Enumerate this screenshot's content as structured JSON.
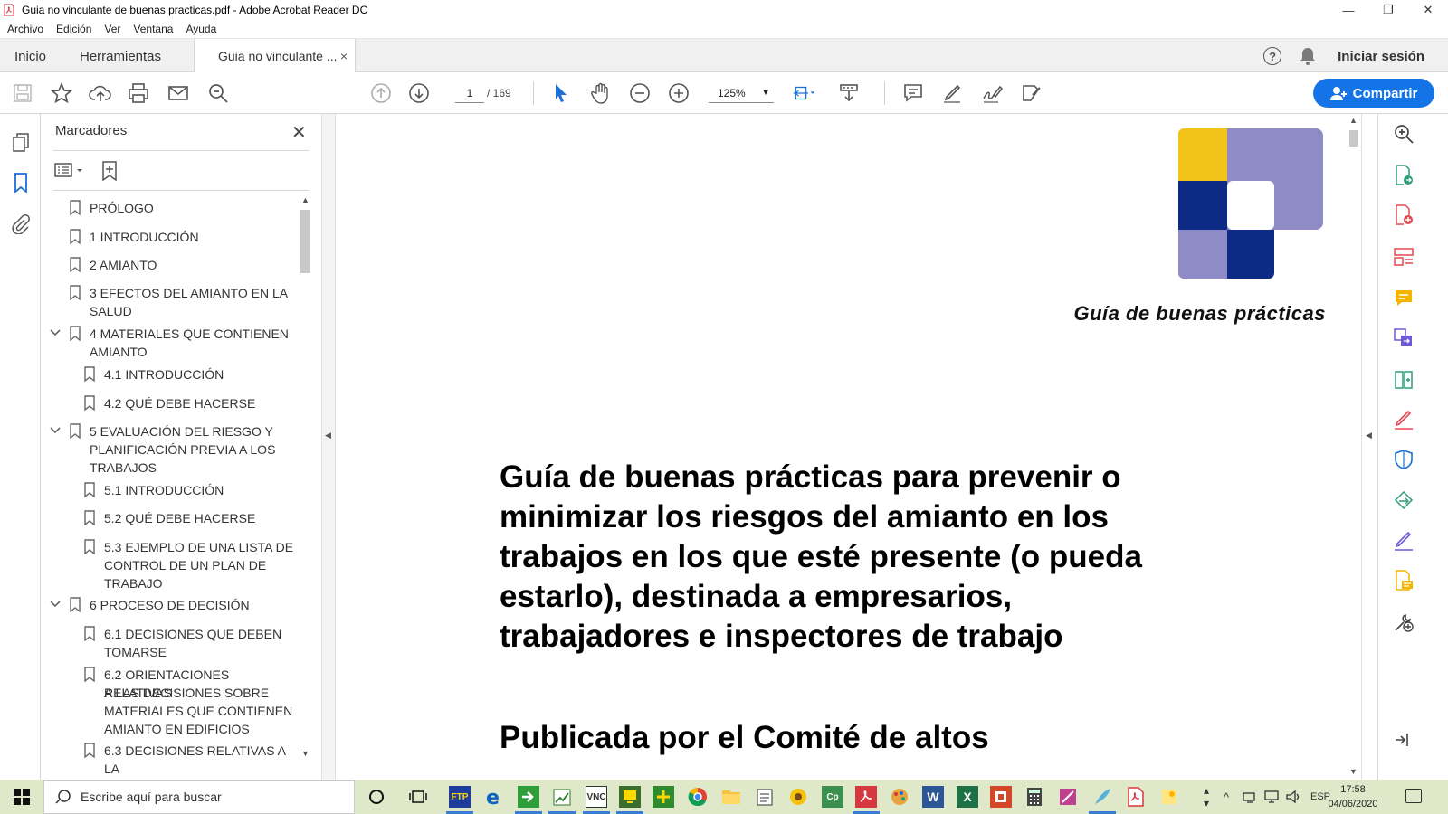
{
  "window": {
    "title": "Guia no vinculante de buenas practicas.pdf - Adobe Acrobat Reader DC",
    "controls": {
      "minimize": "—",
      "restore": "❐",
      "close": "✕"
    }
  },
  "menu": [
    "Archivo",
    "Edición",
    "Ver",
    "Ventana",
    "Ayuda"
  ],
  "tabs": {
    "home": "Inicio",
    "tools": "Herramientas",
    "document": "Guia no vinculante ...",
    "close": "×"
  },
  "header_right": {
    "help": "?",
    "signin": "Iniciar sesión"
  },
  "toolbar": {
    "page_current": "1",
    "page_total": "/   169",
    "zoom": "125%",
    "share_label": "Compartir"
  },
  "bookmarks": {
    "title": "Marcadores",
    "close": "✕",
    "items": [
      {
        "label": "PRÓLOGO",
        "level": 0,
        "expanded": null
      },
      {
        "label": "1 INTRODUCCIÓN",
        "level": 0,
        "expanded": null
      },
      {
        "label": "2 AMIANTO",
        "level": 0,
        "expanded": null
      },
      {
        "label": "3 EFECTOS DEL AMIANTO EN LA",
        "label2": "SALUD",
        "level": 0,
        "expanded": null
      },
      {
        "label": "4 MATERIALES QUE CONTIENEN",
        "label2": "AMIANTO",
        "level": 0,
        "expanded": true
      },
      {
        "label": "4.1 INTRODUCCIÓN",
        "level": 1
      },
      {
        "label": "4.2 QUÉ DEBE HACERSE",
        "level": 1
      },
      {
        "label": "5 EVALUACIÓN DEL RIESGO Y",
        "label2": "PLANIFICACIÓN PREVIA A LOS",
        "label3": "TRABAJOS",
        "level": 0,
        "expanded": true
      },
      {
        "label": "5.1 INTRODUCCIÓN",
        "level": 1
      },
      {
        "label": "5.2 QUÉ DEBE HACERSE",
        "level": 1
      },
      {
        "label": "5.3 EJEMPLO DE UNA LISTA DE",
        "label2": "CONTROL DE UN PLAN DE",
        "label3": "TRABAJO",
        "level": 1
      },
      {
        "label": "6 PROCESO DE DECISIÓN",
        "level": 0,
        "expanded": true
      },
      {
        "label": "6.1 DECISIONES QUE DEBEN",
        "label2": "TOMARSE",
        "level": 1
      },
      {
        "label": "6.2 ORIENTACIONES RELATIVAS",
        "label2": "A LAS DECISIONES SOBRE",
        "label3": "MATERIALES QUE CONTIENEN",
        "label4": "AMIANTO EN EDIFICIOS",
        "level": 1
      },
      {
        "label": "6.3 DECISIONES RELATIVAS A LA",
        "level": 1
      }
    ]
  },
  "document": {
    "header_italic": "Guía de buenas prácticas",
    "title_lines": [
      "Guía de buenas prácticas para prevenir o",
      "minimizar los riesgos del amianto en los",
      "trabajos en los que esté presente (o pueda",
      "estarlo), destinada a empresarios,",
      "trabajadores e inspectores de trabajo"
    ],
    "published_line": "Publicada por el Comité de altos",
    "logo_colors": {
      "yellow": "#f2c318",
      "lavender": "#8e8bc6",
      "navy": "#0d2a84",
      "white": "#ffffff"
    }
  },
  "taskbar": {
    "search_placeholder": "Escribe aquí para buscar",
    "language": "ESP",
    "time": "17:58",
    "date": "04/06/2020"
  },
  "colors": {
    "accent": "#1473e6",
    "taskbar": "#dfe8c8"
  }
}
